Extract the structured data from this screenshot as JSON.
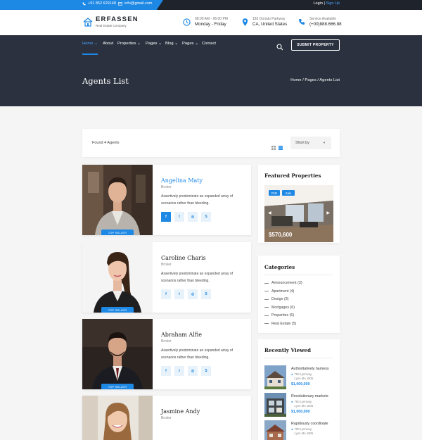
{
  "topbar": {
    "phone": "+91 852 629148",
    "email": "info@gmail.com",
    "login": "Login",
    "separator": "|",
    "signup": "Sign Up"
  },
  "header": {
    "logo_name": "ERFASSEN",
    "logo_tagline": "Real Estate Company",
    "hours": {
      "line1": "08:00 AM - 06:00 PM",
      "line2": "Monday - Friday"
    },
    "address": {
      "line1": "183 Donato Parkway",
      "line2": "CA, United States"
    },
    "service": {
      "line1": "Service Available",
      "line2": "(+00)888.666.88"
    }
  },
  "nav": {
    "items": [
      "Home",
      "About",
      "Properties",
      "Pages",
      "Blog",
      "Pages",
      "Contact"
    ],
    "submit_label": "SUBMIT PROPERTY"
  },
  "banner": {
    "title": "Agents List",
    "breadcrumb": "Home / Pages / Agents List"
  },
  "listing": {
    "found_text": "Found 4 Agents",
    "sort_label": "Short by"
  },
  "agents": [
    {
      "name": "Angelina Maty",
      "role": "Broker",
      "desc": "Assertively predominate an expanded array of scenarios rather than bleeding.",
      "badge": "TOP SELLER"
    },
    {
      "name": "Caroline Charis",
      "role": "Broker",
      "desc": "Assertively predominate an expanded array of scenarios rather than bleeding.",
      "badge": "TOP SELLER"
    },
    {
      "name": "Abraham Alfie",
      "role": "Broker",
      "desc": "Assertively predominate an expanded array of scenarios rather than bleeding.",
      "badge": "TOP SELLER"
    },
    {
      "name": "Jasmine Andy",
      "role": "Broker"
    }
  ],
  "socials": {
    "facebook": "f",
    "twitter": "t",
    "instagram": "◎",
    "skype": "S"
  },
  "featured": {
    "title": "Featured Properties",
    "badge1": "PAR",
    "badge2": "Sale",
    "price": "$570,600"
  },
  "categories": {
    "title": "Categories",
    "items": [
      "Announcement (3)",
      "Apartment (4)",
      "Design (3)",
      "Mortgages (6)",
      "Properties (6)",
      "Real Estate (5)"
    ]
  },
  "recent": {
    "title": "Recently Viewed",
    "items": [
      {
        "title": "Authoritatively harness",
        "addr1": "780 Lynnway,",
        "addr2": "Lynn MA 1905",
        "price": "$1,000,000"
      },
      {
        "title": "Revolutionary markets",
        "addr1": "780 Lynnway,",
        "addr2": "Lynn MA 1905",
        "price": "$1,000,000"
      },
      {
        "title": "Rapidously coordinate",
        "addr1": "780 Lynnway,",
        "addr2": "Lynn MA 1905"
      }
    ]
  },
  "colors": {
    "accent": "#1e88e5",
    "nav_bg": "#2b313e",
    "topbar_bg": "#1f232b"
  }
}
